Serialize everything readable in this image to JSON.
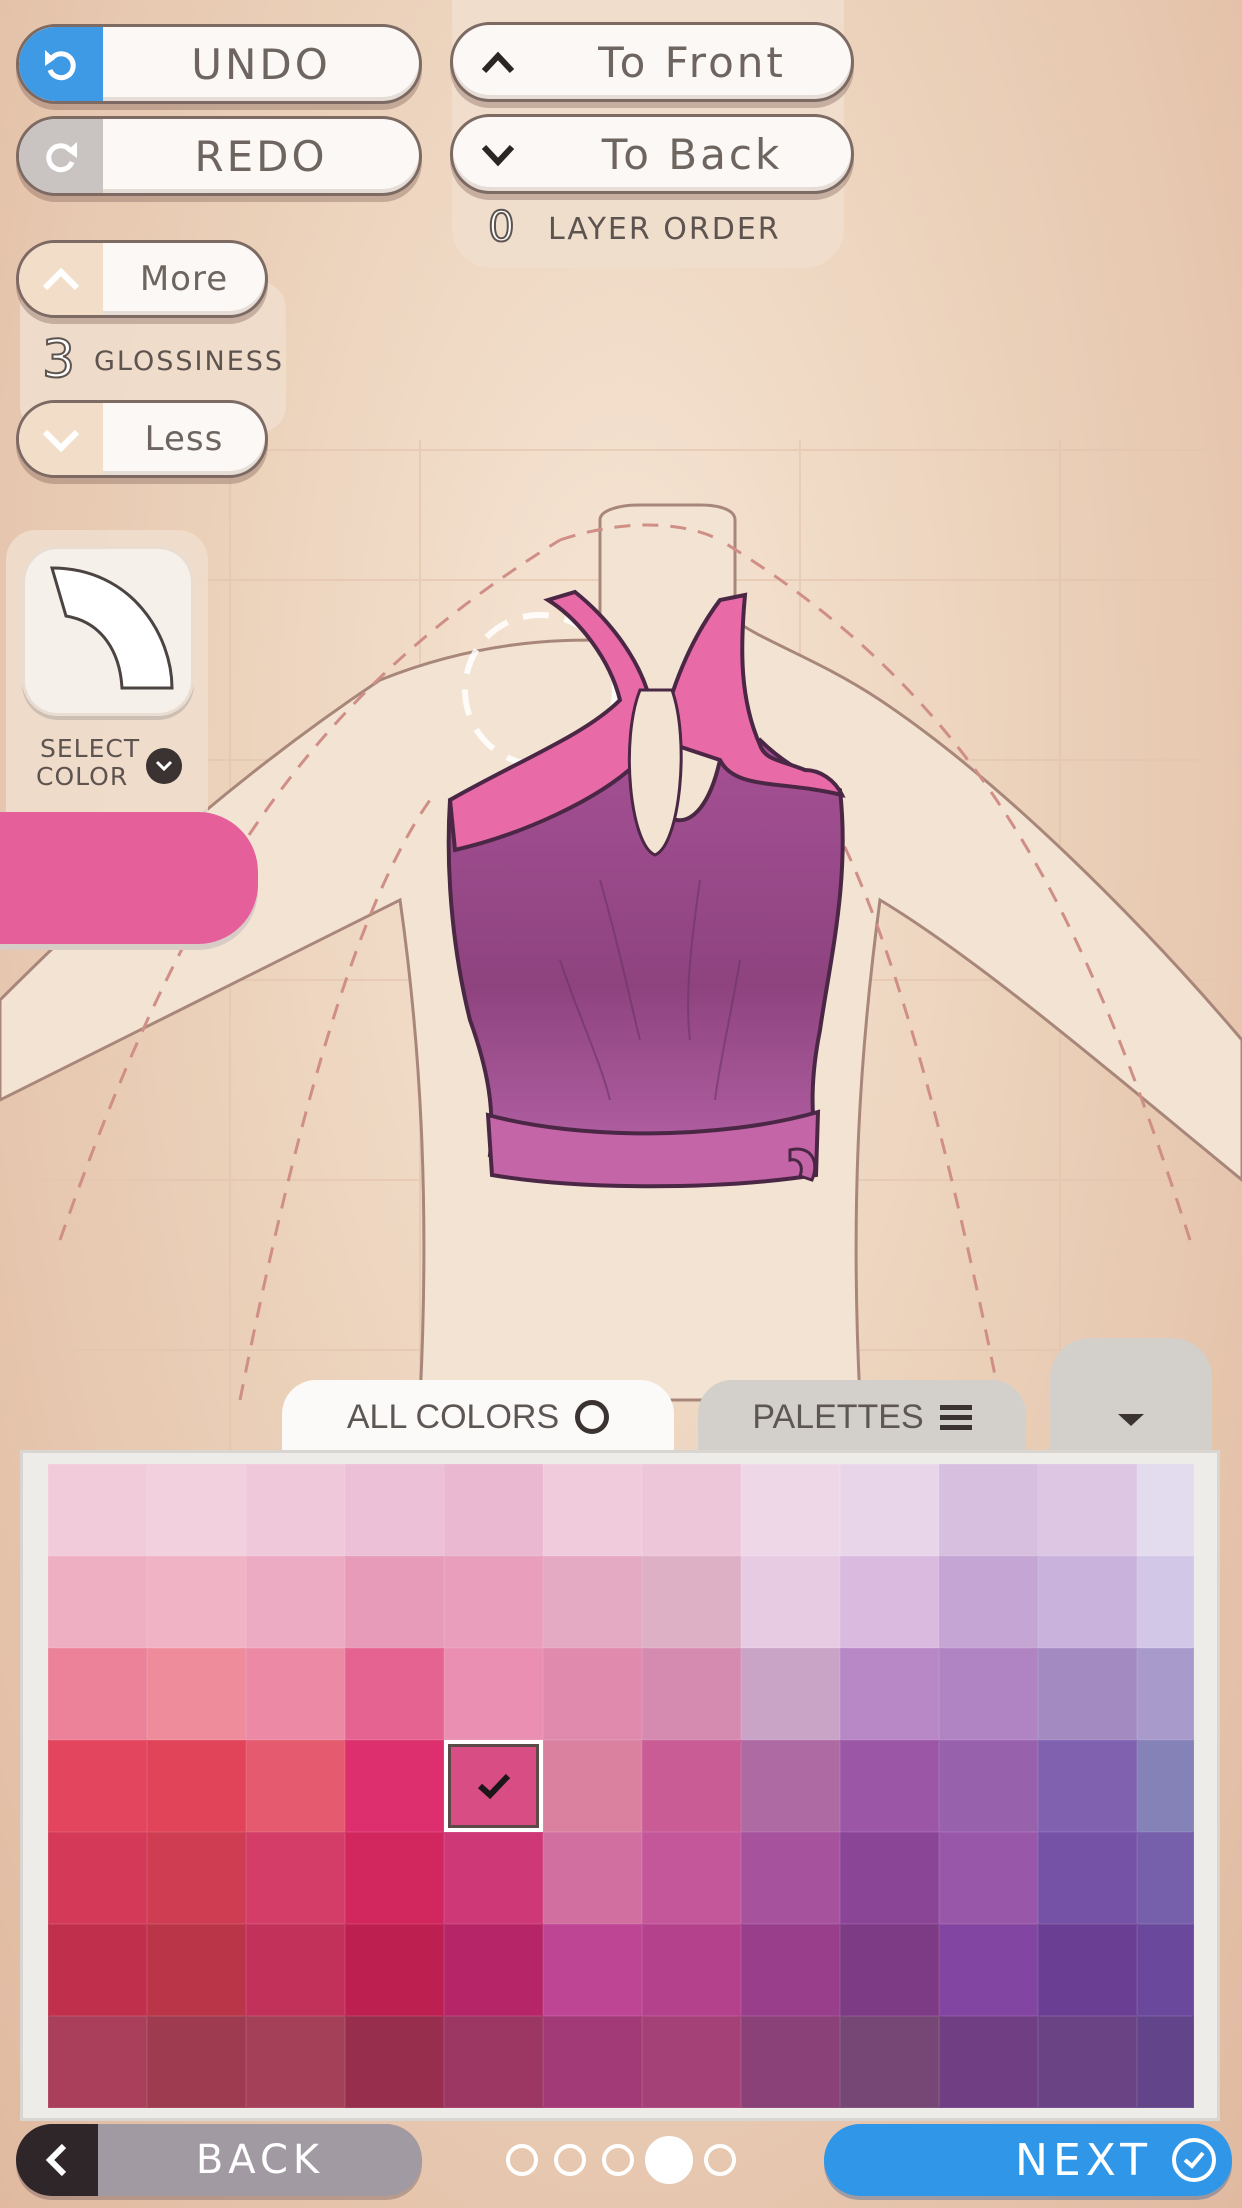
{
  "toolbar": {
    "undo_label": "UNDO",
    "redo_label": "REDO",
    "to_front_label": "To Front",
    "to_back_label": "To Back",
    "layer_order_value": "0",
    "layer_order_label": "LAYER ORDER"
  },
  "glossiness": {
    "more_label": "More",
    "less_label": "Less",
    "value": "3",
    "label": "GLOSSINESS"
  },
  "select_color": {
    "line1": "SELECT",
    "line2": "COLOR",
    "current_color": "#e5609b"
  },
  "tabs": {
    "all_colors": "ALL COLORS",
    "palettes": "PALETTES"
  },
  "palette": {
    "selected": [
      3,
      4
    ],
    "rows": [
      [
        "#f1cbd9",
        "#f3d0de",
        "#efc8da",
        "#ecc0d6",
        "#eab8d1",
        "#f0cbdc",
        "#edc7d9",
        "#eed8e8",
        "#e9d5ea",
        "#d7bfe0",
        "#dcc6e4",
        "#e3dcef"
      ],
      [
        "#eeafc2",
        "#f0b2c5",
        "#ecaac3",
        "#e79bb8",
        "#e99fbb",
        "#e4a9c3",
        "#ddb0c6",
        "#e7cbe3",
        "#dbbae0",
        "#c5a5d3",
        "#c9b2dc",
        "#d3c7e7"
      ],
      [
        "#ec8299",
        "#ee8c9c",
        "#ec8aa5",
        "#e56390",
        "#ea8fb1",
        "#e08aae",
        "#d58ab0",
        "#c9a4c6",
        "#b887c5",
        "#b083c3",
        "#a38ac1",
        "#a89bcb"
      ],
      [
        "#e3455f",
        "#e14358",
        "#e65a6f",
        "#dd2e6d",
        "#d94d85",
        "#d9819f",
        "#c95c94",
        "#ad6aa3",
        "#9b57a5",
        "#9761ac",
        "#8061b0",
        "#8482b6"
      ],
      [
        "#d43957",
        "#cf3d52",
        "#d33d67",
        "#d2275e",
        "#cf3877",
        "#d06fa0",
        "#c35799",
        "#a6529c",
        "#8a4597",
        "#9957aa",
        "#7552a6",
        "#765fab"
      ],
      [
        "#c0304c",
        "#ba3547",
        "#c1315a",
        "#bd1f50",
        "#b62568",
        "#be4594",
        "#b3418c",
        "#983e8b",
        "#7d3a85",
        "#8245a1",
        "#6a3e93",
        "#6a489c"
      ],
      [
        "#a93f5a",
        "#9f3b50",
        "#a44159",
        "#982e4e",
        "#9c3663",
        "#a23a78",
        "#a44277",
        "#8a4177",
        "#764774",
        "#703e83",
        "#6a4384",
        "#614489"
      ]
    ]
  },
  "pager": {
    "count": 5,
    "current": 3
  },
  "footer": {
    "back_label": "BACK",
    "next_label": "NEXT"
  },
  "colors": {
    "accent_blue": "#2f96e8",
    "back_grey": "#a29aa3"
  }
}
